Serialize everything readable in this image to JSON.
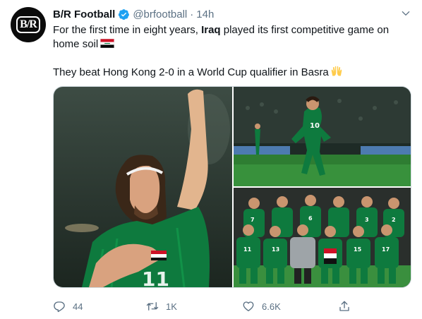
{
  "account": {
    "name": "B/R Football",
    "handle": "@brfootball",
    "separator": "·",
    "time": "14h",
    "avatar_text": "B/R"
  },
  "tweet": {
    "line1_prefix": "For the first time in eight years, ",
    "line1_bold": "Iraq",
    "line1_suffix": " played its first competitive game on home soil",
    "line2": "They beat Hong Kong 2-0 in a World Cup qualifier in Basra"
  },
  "stats": {
    "replies": "44",
    "retweets": "1K",
    "likes": "6.6K"
  },
  "media": {
    "photo1_jersey": "11",
    "photo2_jersey": "10",
    "team_numbers": [
      "7",
      "6",
      "3",
      "2",
      "11",
      "13",
      "15",
      "17"
    ]
  },
  "icons": {
    "verified": "verified-badge-icon",
    "caret": "chevron-down-icon",
    "flag": "iraq-flag-icon",
    "hands": "raising-hands-icon",
    "reply": "reply-icon",
    "retweet": "retweet-icon",
    "like": "heart-icon",
    "share": "share-icon"
  },
  "colors": {
    "accent": "#1da1f2",
    "text": "#0f1419",
    "muted": "#5b7083",
    "jersey_green": "#0e7a3e"
  }
}
